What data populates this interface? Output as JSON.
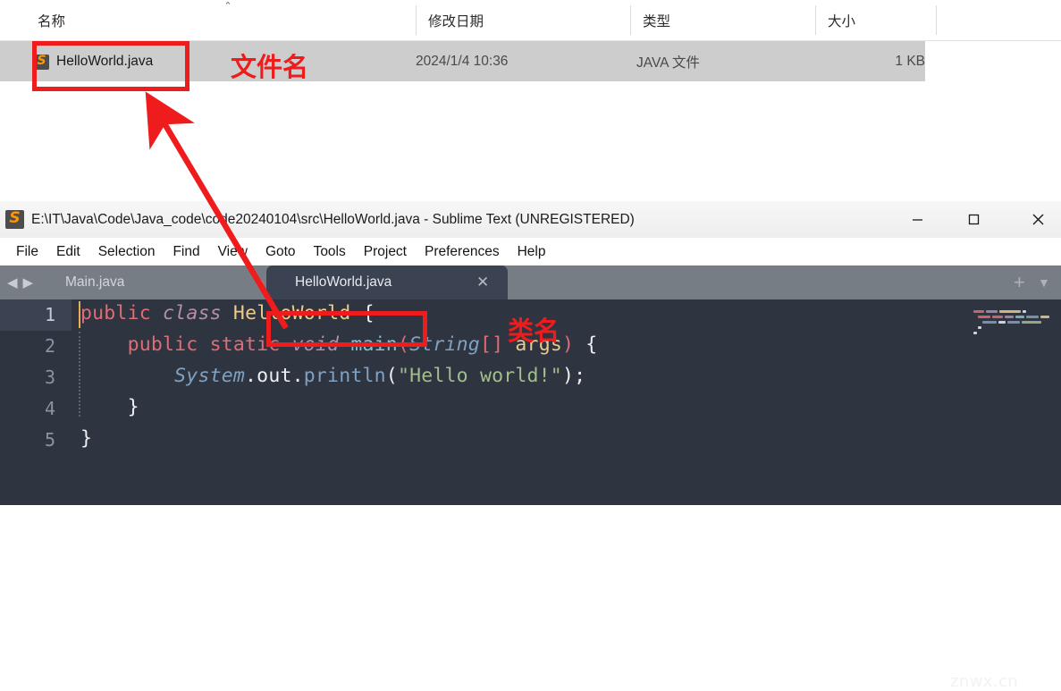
{
  "explorer": {
    "columns": [
      {
        "label": "名称",
        "key": "name"
      },
      {
        "label": "修改日期",
        "key": "modified"
      },
      {
        "label": "类型",
        "key": "type"
      },
      {
        "label": "大小",
        "key": "size"
      }
    ],
    "sort_indicator": "⌃",
    "rows": [
      {
        "name": "HelloWorld.java",
        "modified": "2024/1/4 10:36",
        "type": "JAVA 文件",
        "size": "1 KB",
        "icon": "sublime-text-file-icon",
        "selected": true
      }
    ]
  },
  "sublime": {
    "title": "E:\\IT\\Java\\Code\\Java_code\\code20240104\\src\\HelloWorld.java - Sublime Text (UNREGISTERED)",
    "app_icon": "sublime-text-icon",
    "window_controls": {
      "minimize": "—",
      "maximize": "▢",
      "close": "✕"
    },
    "menu": [
      "File",
      "Edit",
      "Selection",
      "Find",
      "View",
      "Goto",
      "Tools",
      "Project",
      "Preferences",
      "Help"
    ],
    "nav": {
      "back": "◀",
      "forward": "▶"
    },
    "tabs": [
      {
        "label": "Main.java",
        "active": false,
        "dirty": true,
        "close": ""
      },
      {
        "label": "HelloWorld.java",
        "active": true,
        "dirty": false,
        "close": "✕"
      }
    ],
    "tab_actions": {
      "new_tab": "+",
      "tab_list": "▼"
    },
    "watermark": "znwx.cn",
    "editor": {
      "line_numbers": [
        "1",
        "2",
        "3",
        "4",
        "5"
      ],
      "active_line": 1,
      "lines": [
        {
          "n": "1",
          "tokens": [
            {
              "t": "public",
              "c": "k-red"
            },
            {
              "t": " ",
              "c": "k-white"
            },
            {
              "t": "class",
              "c": "k-purp"
            },
            {
              "t": " ",
              "c": "k-white"
            },
            {
              "t": "HelloWorld",
              "c": "k-org"
            },
            {
              "t": " {",
              "c": "k-white"
            }
          ]
        },
        {
          "n": "2",
          "tokens": [
            {
              "t": "    ",
              "c": "k-white"
            },
            {
              "t": "public static",
              "c": "k-red"
            },
            {
              "t": " ",
              "c": "k-white"
            },
            {
              "t": "void",
              "c": "k-purp"
            },
            {
              "t": " ",
              "c": "k-white"
            },
            {
              "t": "main",
              "c": "k-teal"
            },
            {
              "t": "(",
              "c": "k-red"
            },
            {
              "t": "String",
              "c": "k-blue"
            },
            {
              "t": "[]",
              "c": "k-red"
            },
            {
              "t": " ",
              "c": "k-white"
            },
            {
              "t": "args",
              "c": "k-org"
            },
            {
              "t": ")",
              "c": "k-red"
            },
            {
              "t": " {",
              "c": "k-white"
            }
          ]
        },
        {
          "n": "3",
          "tokens": [
            {
              "t": "        ",
              "c": "k-white"
            },
            {
              "t": "System",
              "c": "k-blue"
            },
            {
              "t": ".out.",
              "c": "k-white"
            },
            {
              "t": "println",
              "c": "k-blue2"
            },
            {
              "t": "(",
              "c": "k-white"
            },
            {
              "t": "\"Hello world!\"",
              "c": "k-green"
            },
            {
              "t": ");",
              "c": "k-white"
            }
          ]
        },
        {
          "n": "4",
          "tokens": [
            {
              "t": "    }",
              "c": "k-white"
            }
          ]
        },
        {
          "n": "5",
          "tokens": [
            {
              "t": "}",
              "c": "k-white"
            }
          ]
        }
      ]
    }
  },
  "annotations": [
    {
      "text": "文件名",
      "target": "filename-in-explorer"
    },
    {
      "text": "类名",
      "target": "classname-in-code"
    }
  ],
  "colors": {
    "annotation_red": "#ee1c1c",
    "editor_bg": "#2e3440",
    "tabbar_bg": "#777d85",
    "active_tab_bg": "#3b4252",
    "selection_bg": "#cdcdcd"
  }
}
